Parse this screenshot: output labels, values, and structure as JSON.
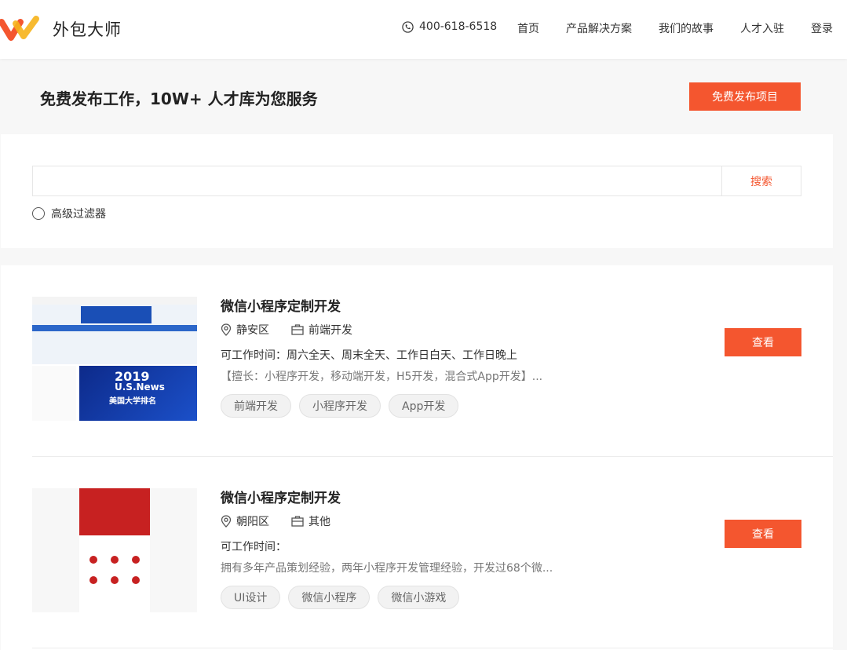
{
  "header": {
    "brand": "外包大师",
    "phone": "400-618-6518",
    "nav": [
      "首页",
      "产品解决方案",
      "我们的故事",
      "人才入驻",
      "登录"
    ],
    "accent_color": "#f4562f"
  },
  "banner": {
    "title": "免费发布工作，10W+ 人才库为您服务",
    "publish_button": "免费发布项目"
  },
  "search": {
    "placeholder": "",
    "button": "搜索",
    "advanced_filter": "高级过滤器"
  },
  "projects": [
    {
      "title": "微信小程序定制开发",
      "location": "静安区",
      "category": "前端开发",
      "availability": "可工作时间：周六全天、周末全天、工作日白天、工作日晚上",
      "description": "【擅长：小程序开发，移动端开发，H5开发，混合式App开发】...",
      "tags": [
        "前端开发",
        "小程序开发",
        "App开发"
      ],
      "view_button": "查看",
      "thumb_text": [
        "2019",
        "U.S.News",
        "美国大学排名"
      ]
    },
    {
      "title": "微信小程序定制开发",
      "location": "朝阳区",
      "category": "其他",
      "availability": "可工作时间：",
      "description": "拥有多年产品策划经验，两年小程序开发管理经验，开发过68个微...",
      "tags": [
        "UI设计",
        "微信小程序",
        "微信小游戏"
      ],
      "view_button": "查看"
    }
  ]
}
